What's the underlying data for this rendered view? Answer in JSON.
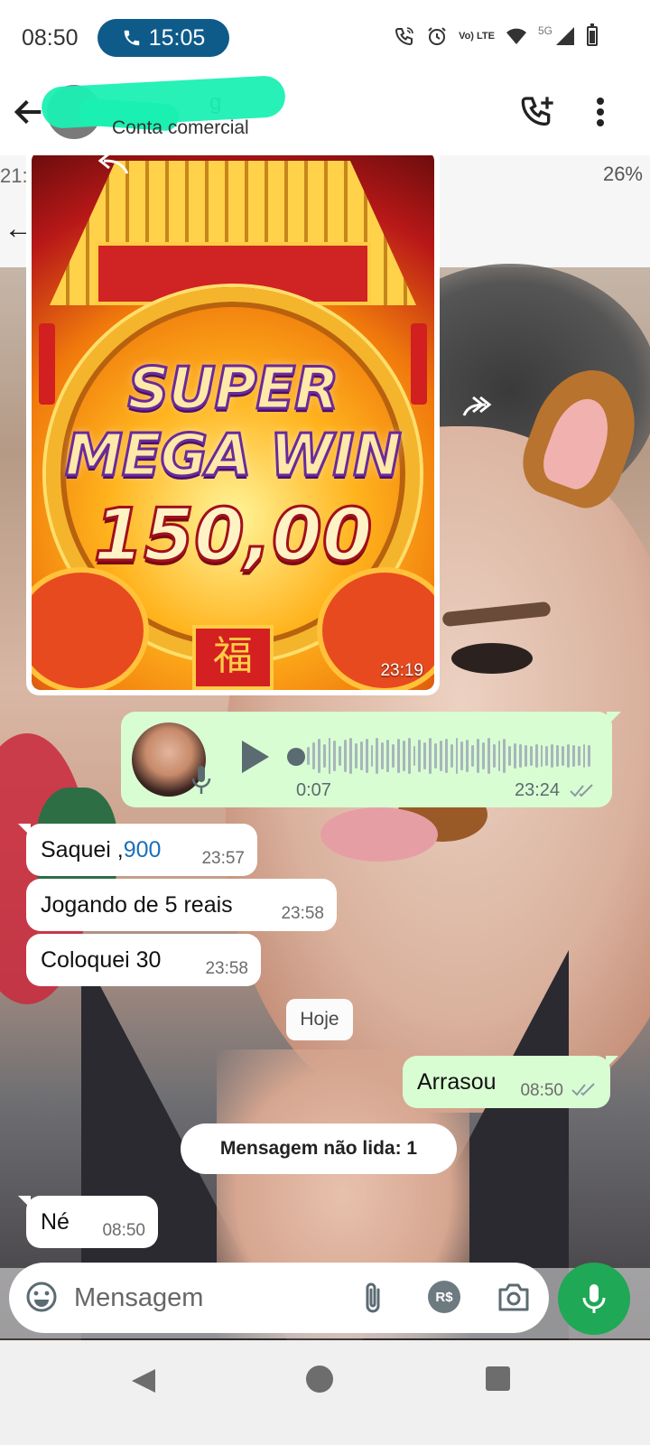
{
  "status_bar": {
    "time": "08:50",
    "call_timer": "15:05",
    "network": "5G",
    "volte": "Vo) LTE",
    "icons": [
      "wifi-call-icon",
      "alarm-icon",
      "volte-icon",
      "wifi-icon",
      "signal-icon",
      "battery-icon"
    ]
  },
  "header": {
    "contact_name": "g",
    "contact_subtitle": "Conta comercial",
    "icons": [
      "back-arrow-icon",
      "add-call-icon",
      "more-vert-icon"
    ]
  },
  "wallpaper": {
    "time_fragment": "21:",
    "battery_text": "26%"
  },
  "messages": {
    "image": {
      "line1": "SUPER",
      "line2": "MEGA WIN",
      "amount": "150,00",
      "glyph": "福",
      "time": "23:19"
    },
    "voice": {
      "duration": "0:07",
      "time": "23:24",
      "waveform": [
        20,
        30,
        38,
        26,
        40,
        34,
        22,
        36,
        40,
        28,
        32,
        38,
        24,
        40,
        30,
        36,
        26,
        38,
        34,
        40,
        22,
        36,
        30,
        40,
        28,
        34,
        38,
        26,
        40,
        32,
        36,
        24,
        38,
        30,
        40,
        26,
        34,
        38,
        22,
        28,
        26,
        24,
        22,
        26,
        24,
        22,
        26,
        24,
        22,
        26,
        24,
        22,
        26,
        24
      ]
    },
    "incoming": [
      {
        "text": "Saquei ,",
        "link": "900",
        "time": "23:57"
      },
      {
        "text": "Jogando de 5 reais",
        "time": "23:58"
      },
      {
        "text": "Coloquei 30",
        "time": "23:58"
      }
    ],
    "date_chip": "Hoje",
    "outgoing_1": {
      "text": "Arrasou",
      "time": "08:50"
    },
    "unread_label": "Mensagem não lida: 1",
    "incoming_last": {
      "text": "Né",
      "time": "08:50"
    }
  },
  "input": {
    "placeholder": "Mensagem",
    "pay_label": "R$"
  },
  "colors": {
    "accent_green": "#1fa855",
    "outgoing_bubble": "#d9fdd3",
    "call_pill": "#0e5b8a",
    "link_blue": "#1a6fb9"
  }
}
